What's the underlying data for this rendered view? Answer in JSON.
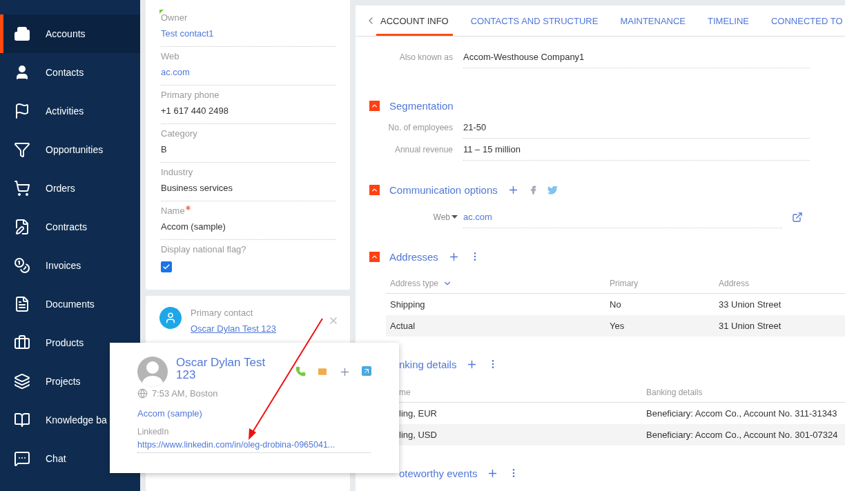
{
  "sidebar": {
    "items": [
      {
        "label": "Accounts",
        "selected": true
      },
      {
        "label": "Contacts",
        "selected": false
      },
      {
        "label": "Activities",
        "selected": false
      },
      {
        "label": "Opportunities",
        "selected": false
      },
      {
        "label": "Orders",
        "selected": false
      },
      {
        "label": "Contracts",
        "selected": false
      },
      {
        "label": "Invoices",
        "selected": false
      },
      {
        "label": "Documents",
        "selected": false
      },
      {
        "label": "Products",
        "selected": false
      },
      {
        "label": "Projects",
        "selected": false
      },
      {
        "label": "Knowledge ba",
        "selected": false
      },
      {
        "label": "Chat",
        "selected": false
      }
    ]
  },
  "profile_card": {
    "fields": [
      {
        "label": "Owner",
        "value": "Test contact1",
        "kind": "link",
        "required": false,
        "marked": true
      },
      {
        "label": "Web",
        "value": "ac.com",
        "kind": "link",
        "required": false,
        "marked": false
      },
      {
        "label": "Primary phone",
        "value": "+1 617 440 2498",
        "kind": "text",
        "required": false,
        "marked": false
      },
      {
        "label": "Category",
        "value": "B",
        "kind": "text",
        "required": false,
        "marked": false
      },
      {
        "label": "Industry",
        "value": "Business services",
        "kind": "text",
        "required": false,
        "marked": false
      },
      {
        "label": "Name",
        "value": "Accom (sample)",
        "kind": "text",
        "required": true,
        "marked": false
      }
    ],
    "flag": {
      "label": "Display national flag?",
      "checked": true
    }
  },
  "primary_contact": {
    "label": "Primary contact",
    "name": "Oscar Dylan Test 123"
  },
  "contact_popup": {
    "name": "Oscar Dylan Test 123",
    "time": "7:53 AM, Boston",
    "account": "Accom (sample)",
    "linkedin_label": "LinkedIn",
    "linkedin_url": "https://www.linkedin.com/in/oleg-drobina-0965041..."
  },
  "tabs": [
    {
      "label": "ACCOUNT INFO",
      "selected": true
    },
    {
      "label": "CONTACTS AND STRUCTURE",
      "selected": false
    },
    {
      "label": "MAINTENANCE",
      "selected": false
    },
    {
      "label": "TIMELINE",
      "selected": false
    },
    {
      "label": "CONNECTED TO",
      "selected": false
    }
  ],
  "also_known_as": {
    "label": "Also known as",
    "value": "Accom-Westhouse Company1"
  },
  "segmentation": {
    "title": "Segmentation",
    "expanded": true,
    "fields": [
      {
        "label": "No. of employees",
        "value": "21-50"
      },
      {
        "label": "Annual revenue",
        "value": "11 – 15 million"
      }
    ]
  },
  "communication": {
    "title": "Communication options",
    "expanded": true,
    "type": "Web",
    "value": "ac.com"
  },
  "addresses": {
    "title": "Addresses",
    "expanded": true,
    "columns": [
      "Address type",
      "Primary",
      "Address"
    ],
    "rows": [
      [
        "Shipping",
        "No",
        "33 Union Street"
      ],
      [
        "Actual",
        "Yes",
        "31 Union Street"
      ]
    ]
  },
  "banking": {
    "title": "nking details",
    "columns": [
      "me",
      "Banking details"
    ],
    "rows": [
      [
        "ling, EUR",
        "Beneficiary: Accom Co., Account No. 311-31343"
      ],
      [
        "ling, USD",
        "Beneficiary: Accom Co., Account No. 301-07324"
      ]
    ]
  },
  "noteworthy": {
    "title": "oteworthy events"
  }
}
